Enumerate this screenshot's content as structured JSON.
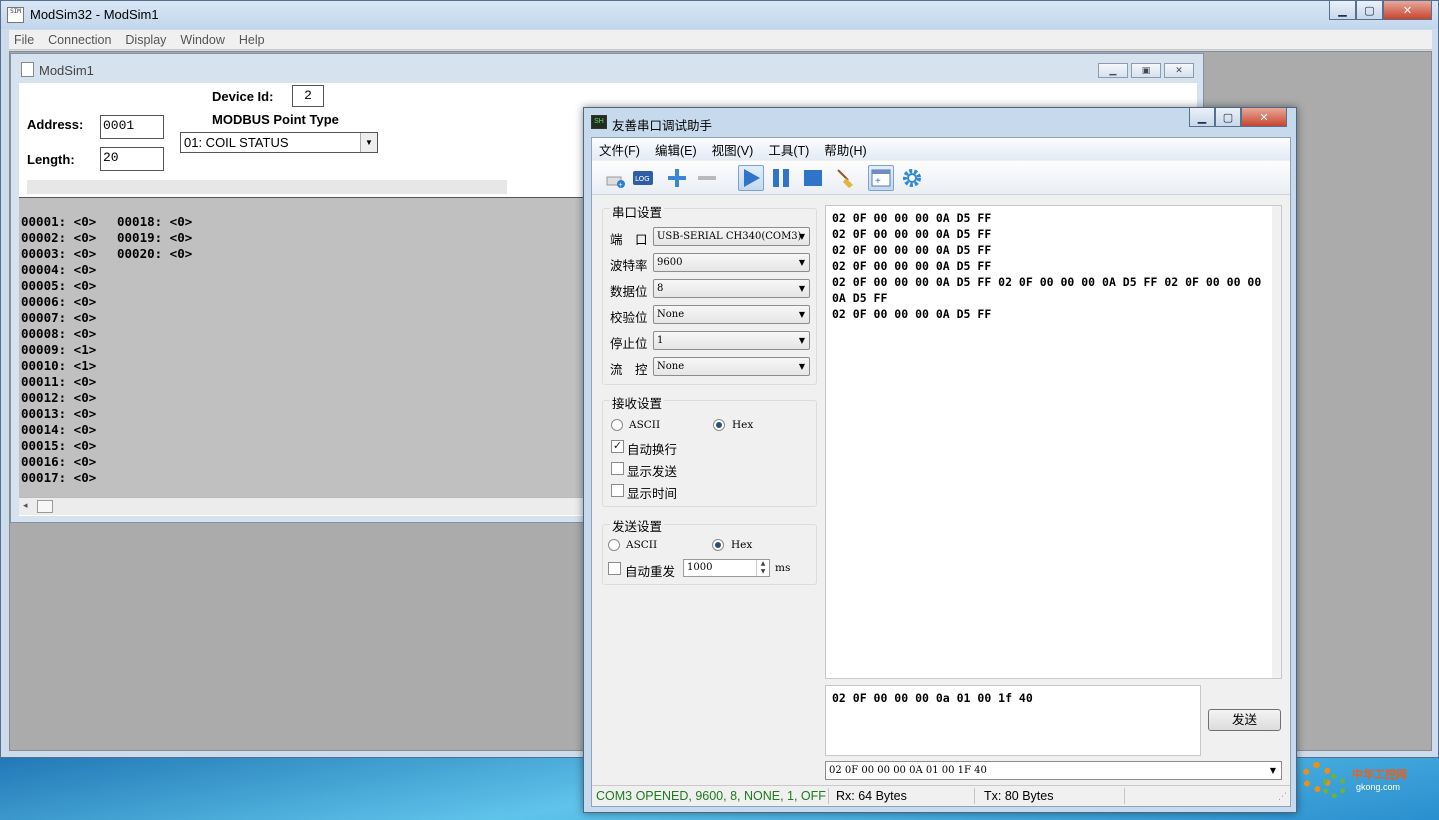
{
  "main_window": {
    "title": "ModSim32 - ModSim1",
    "icon_text": "SIM",
    "menu": [
      "File",
      "Connection",
      "Display",
      "Window",
      "Help"
    ]
  },
  "child_window": {
    "title": "ModSim1",
    "device_id_label": "Device Id:",
    "device_id": "2",
    "address_label": "Address:",
    "address": "0001",
    "length_label": "Length:",
    "length": "20",
    "point_type_label": "MODBUS Point Type",
    "point_type": "01: COIL STATUS",
    "col1": [
      "00001: <0>",
      "00002: <0>",
      "00003: <0>",
      "00004: <0>",
      "00005: <0>",
      "00006: <0>",
      "00007: <0>",
      "00008: <0>",
      "00009: <1>",
      "00010: <1>",
      "00011: <0>",
      "00012: <0>",
      "00013: <0>",
      "00014: <0>",
      "00015: <0>",
      "00016: <0>",
      "00017: <0>"
    ],
    "col2": [
      "00018: <0>",
      "00019: <0>",
      "00020: <0>"
    ]
  },
  "serial_window": {
    "title": "友善串口调试助手",
    "menu": [
      "文件(F)",
      "编辑(E)",
      "视图(V)",
      "工具(T)",
      "帮助(H)"
    ],
    "port_group": "串口设置",
    "port_label": "端　口",
    "port_value": "USB-SERIAL CH340(COM3)",
    "baud_label": "波特率",
    "baud_value": "9600",
    "databits_label": "数据位",
    "databits_value": "8",
    "parity_label": "校验位",
    "parity_value": "None",
    "stopbits_label": "停止位",
    "stopbits_value": "1",
    "flow_label": "流　控",
    "flow_value": "None",
    "recv_group": "接收设置",
    "recv_ascii": "ASCII",
    "recv_hex": "Hex",
    "auto_wrap": "自动换行",
    "show_send": "显示发送",
    "show_time": "显示时间",
    "send_group": "发送设置",
    "send_ascii": "ASCII",
    "send_hex": "Hex",
    "auto_resend": "自动重发",
    "resend_interval": "1000",
    "interval_unit": "ms",
    "recv_lines": [
      "02 0F 00 00 00 0A D5 FF",
      "02 0F 00 00 00 0A D5 FF",
      "02 0F 00 00 00 0A D5 FF",
      "02 0F 00 00 00 0A D5 FF",
      "02 0F 00 00 00 0A D5 FF 02 0F 00 00 00 0A D5 FF 02 0F 00 00 00 0A D5 FF",
      "02 0F 00 00 00 0A D5 FF"
    ],
    "send_text": "02 0F 00 00 00 0a 01 00 1f 40",
    "send_button": "发送",
    "history_value": "02 0F 00 00 00 0A 01 00 1F 40",
    "status_port": "COM3 OPENED, 9600, 8, NONE, 1, OFF",
    "status_rx": "Rx: 64 Bytes",
    "status_tx": "Tx: 80 Bytes"
  },
  "watermark": {
    "text": "中华工控网",
    "sub": "gkong.com"
  },
  "colors": {
    "status_green": "#1d7a1d",
    "title_bar": "#c2d6ec",
    "mdi_bg": "#ababab"
  }
}
